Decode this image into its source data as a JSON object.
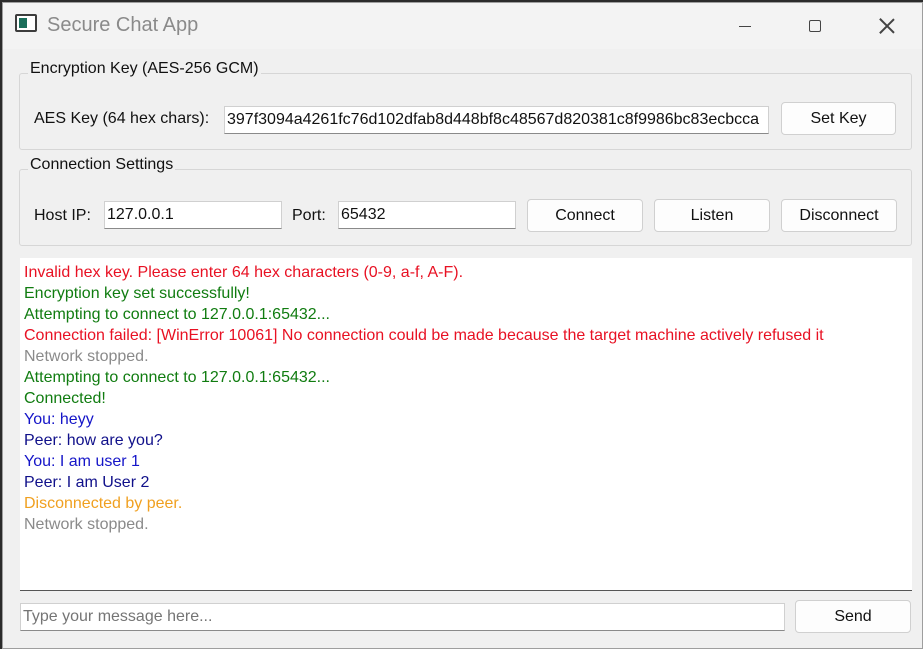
{
  "window": {
    "title": "Secure Chat App"
  },
  "encryption": {
    "group_title": "Encryption Key (AES-256 GCM)",
    "key_label": "AES Key (64 hex chars):",
    "key_value": "397f3094a4261fc76d102dfab8d448bf8c48567d820381c8f9986bc83ecbcca",
    "set_key_label": "Set Key"
  },
  "connection": {
    "group_title": "Connection Settings",
    "host_label": "Host IP:",
    "host_value": "127.0.0.1",
    "port_label": "Port:",
    "port_value": "65432",
    "connect_label": "Connect",
    "listen_label": "Listen",
    "disconnect_label": "Disconnect"
  },
  "log": [
    {
      "text": "Invalid hex key. Please enter 64 hex characters (0-9, a-f, A-F).",
      "color": "#e81123"
    },
    {
      "text": "Encryption key set successfully!",
      "color": "#107c10"
    },
    {
      "text": "Attempting to connect to 127.0.0.1:65432...",
      "color": "#107c10"
    },
    {
      "text": "Connection failed: [WinError 10061] No connection could be made because the target machine actively refused it",
      "color": "#e81123"
    },
    {
      "text": "Network stopped.",
      "color": "#8a8a8a"
    },
    {
      "text": "Attempting to connect to 127.0.0.1:65432...",
      "color": "#107c10"
    },
    {
      "text": "Connected!",
      "color": "#107c10"
    },
    {
      "text": "You: heyy",
      "color": "#1515c8"
    },
    {
      "text": "Peer: how are you?",
      "color": "#10108a"
    },
    {
      "text": "You: I am user 1",
      "color": "#1515c8"
    },
    {
      "text": "Peer: I am User 2",
      "color": "#10108a"
    },
    {
      "text": "Disconnected by peer.",
      "color": "#f0a020"
    },
    {
      "text": "Network stopped.",
      "color": "#8a8a8a"
    }
  ],
  "composer": {
    "placeholder": "Type your message here...",
    "value": "",
    "send_label": "Send"
  }
}
